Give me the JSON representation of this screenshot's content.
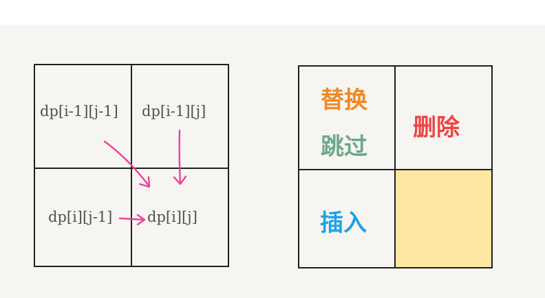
{
  "left_grid": {
    "top_left": "dp[i-1][j-1]",
    "top_right": "dp[i-1][j]",
    "bottom_left": "dp[i][j-1]",
    "bottom_right": "dp[i][j]"
  },
  "right_grid": {
    "replace_label": "替换",
    "skip_label": "跳过",
    "delete_label": "删除",
    "insert_label": "插入"
  },
  "colors": {
    "arrow": "#e8439b",
    "replace": "#f08a24",
    "skip": "#6aa88a",
    "delete": "#ee4444",
    "insert": "#1aa3e8",
    "target_fill": "#fbe6a2"
  }
}
